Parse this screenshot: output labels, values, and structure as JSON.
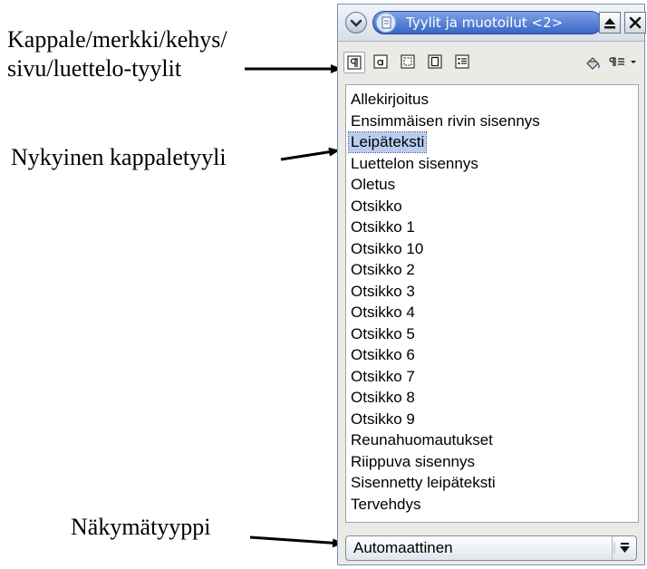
{
  "callouts": {
    "style_families": [
      "Kappale/merkki/kehys/",
      "sivu/luettelo-tyylit"
    ],
    "current_style": "Nykyinen kappaletyyli",
    "view_type": "Näkymätyyppi"
  },
  "window": {
    "title": "Tyylit ja muotoilut <2>",
    "menu_icon": "chevron-down-icon",
    "app_icon": "document-icon",
    "restore_icon": "eject-icon",
    "close_icon": "close-icon"
  },
  "toolbar": {
    "families": [
      {
        "icon": "paragraph-styles-icon",
        "active": true
      },
      {
        "icon": "character-styles-icon",
        "active": false
      },
      {
        "icon": "frame-styles-icon",
        "active": false
      },
      {
        "icon": "page-styles-icon",
        "active": false
      },
      {
        "icon": "list-styles-icon",
        "active": false
      }
    ],
    "fill_format_icon": "fill-format-icon",
    "new_style_icon": "new-style-menu-icon"
  },
  "styles_list": {
    "items": [
      "Allekirjoitus",
      "Ensimmäisen rivin sisennys",
      "Leipäteksti",
      "Luettelon sisennys",
      "Oletus",
      "Otsikko",
      "Otsikko 1",
      "Otsikko 10",
      "Otsikko 2",
      "Otsikko 3",
      "Otsikko 4",
      "Otsikko 5",
      "Otsikko 6",
      "Otsikko 7",
      "Otsikko 8",
      "Otsikko 9",
      "Reunahuomautukset",
      "Riippuva sisennys",
      "Sisennetty leipäteksti",
      "Tervehdys"
    ],
    "selected": "Leipäteksti"
  },
  "filter": {
    "value": "Automaattinen",
    "icon": "dropdown-arrow-icon"
  },
  "colors": {
    "title_accent": "#3866c6",
    "selection": "#b9cdf0",
    "window_bg": "#eceae5"
  }
}
